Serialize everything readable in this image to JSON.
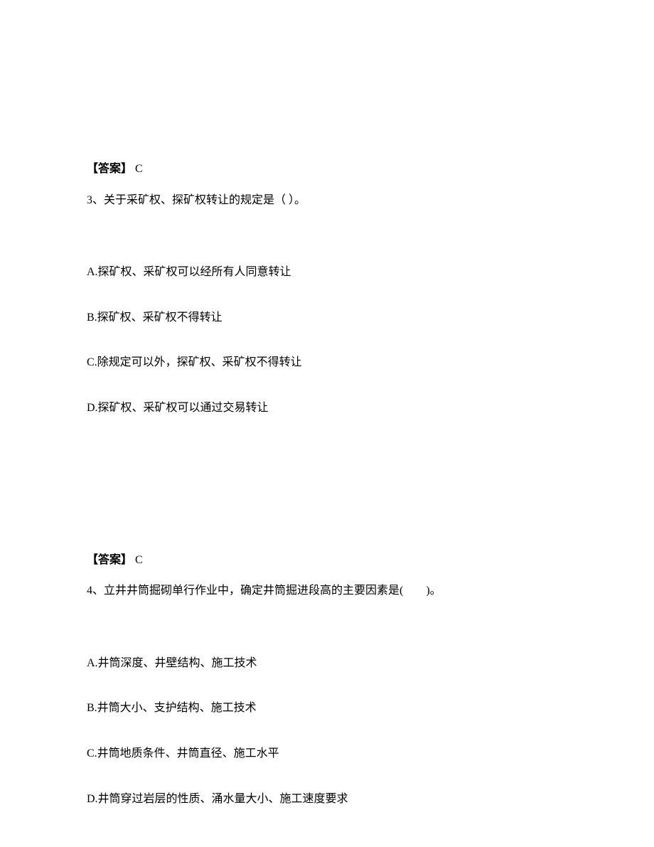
{
  "block1": {
    "answer_label": "【答案】",
    "answer_value": " C",
    "question_num": "3、",
    "question_text": "关于采矿权、探矿权转让的规定是（ ）。",
    "options": {
      "A": "A.探矿权、采矿权可以经所有人同意转让",
      "B": "B.探矿权、采矿权不得转让",
      "C": "C.除规定可以外，探矿权、采矿权不得转让",
      "D": "D.探矿权、采矿权可以通过交易转让"
    }
  },
  "block2": {
    "answer_label": "【答案】",
    "answer_value": " C",
    "question_num": "4、",
    "question_text": "立井井筒掘砌单行作业中，确定井筒掘进段高的主要因素是(　　)。",
    "options": {
      "A": "A.井筒深度、井壁结构、施工技术",
      "B": "B.井筒大小、支护结构、施工技术",
      "C": "C.井筒地质条件、井筒直径、施工水平",
      "D": "D.井筒穿过岩层的性质、涌水量大小、施工速度要求"
    }
  }
}
